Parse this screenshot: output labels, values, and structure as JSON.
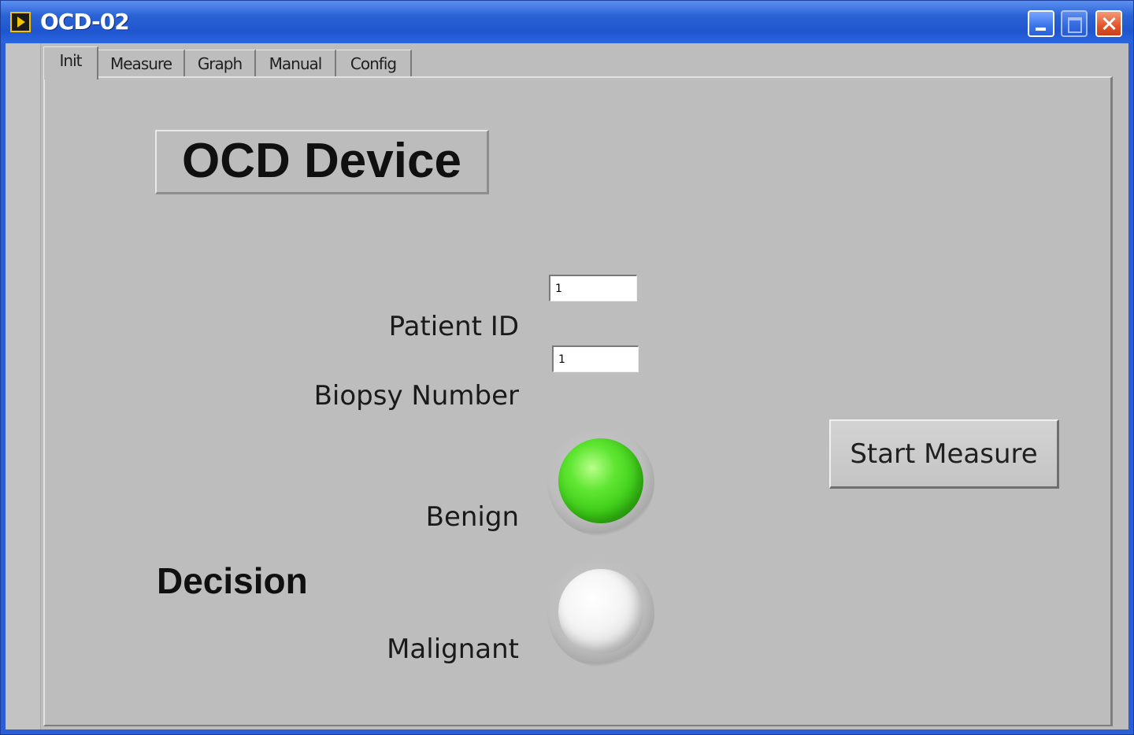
{
  "window": {
    "title": "OCD-02"
  },
  "tabs": [
    {
      "label": "Init",
      "active": true
    },
    {
      "label": "Measure",
      "active": false
    },
    {
      "label": "Graph",
      "active": false
    },
    {
      "label": "Manual",
      "active": false
    },
    {
      "label": "Config",
      "active": false
    }
  ],
  "panel": {
    "title": "OCD Device",
    "patient_id": {
      "label": "Patient ID",
      "value": "1"
    },
    "biopsy_number": {
      "label": "Biopsy Number",
      "value": "1"
    },
    "decision": {
      "label": "Decision",
      "benign": {
        "label": "Benign",
        "state": "on",
        "color": "#4ddc22"
      },
      "malignant": {
        "label": "Malignant",
        "state": "off",
        "color": "#ffffff"
      }
    },
    "start_button_label": "Start Measure"
  },
  "colors": {
    "titlebar": "#2b63d6",
    "panel_background": "#bdbdbd"
  },
  "icons": {
    "app": "labview-run-icon",
    "minimize": "minimize-icon",
    "maximize": "maximize-icon",
    "close": "close-icon"
  }
}
